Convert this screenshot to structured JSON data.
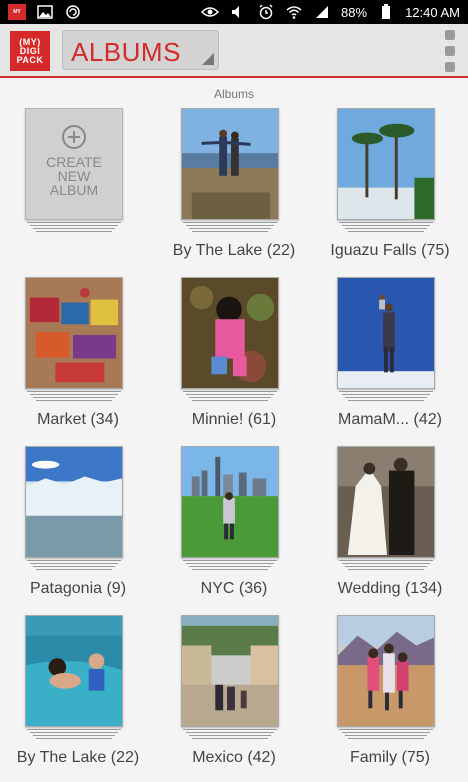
{
  "status": {
    "battery": "88%",
    "time": "12:40 AM"
  },
  "app_bar": {
    "logo_lines": [
      "(MY)",
      "DIGI",
      "PACK"
    ],
    "title": "ALBUMS"
  },
  "page_caption": "Albums",
  "create": {
    "line1": "CREATE",
    "line2": "NEW",
    "line3": "ALBUM"
  },
  "albums": [
    {
      "label": "By The Lake (22)",
      "photo": "couple-by-lake"
    },
    {
      "label": "Iguazu Falls (75)",
      "photo": "palm-trees-waterfall"
    },
    {
      "label": "Market (34)",
      "photo": "market-textiles"
    },
    {
      "label": "Minnie! (61)",
      "photo": "child-in-pink"
    },
    {
      "label": "MamaM... (42)",
      "photo": "salt-flat-perspective"
    },
    {
      "label": "Patagonia (9)",
      "photo": "glacier"
    },
    {
      "label": "NYC (36)",
      "photo": "city-skyline-park"
    },
    {
      "label": "Wedding (134)",
      "photo": "wedding-couple"
    },
    {
      "label": "By The Lake (22)",
      "photo": "swimming-pool-kids"
    },
    {
      "label": "Mexico (42)",
      "photo": "street-scene"
    },
    {
      "label": "Family (75)",
      "photo": "family-mountains"
    }
  ],
  "colors": {
    "brand": "#d42a2a",
    "appbar": "#e6e6e6",
    "background": "#f4f4f4"
  }
}
